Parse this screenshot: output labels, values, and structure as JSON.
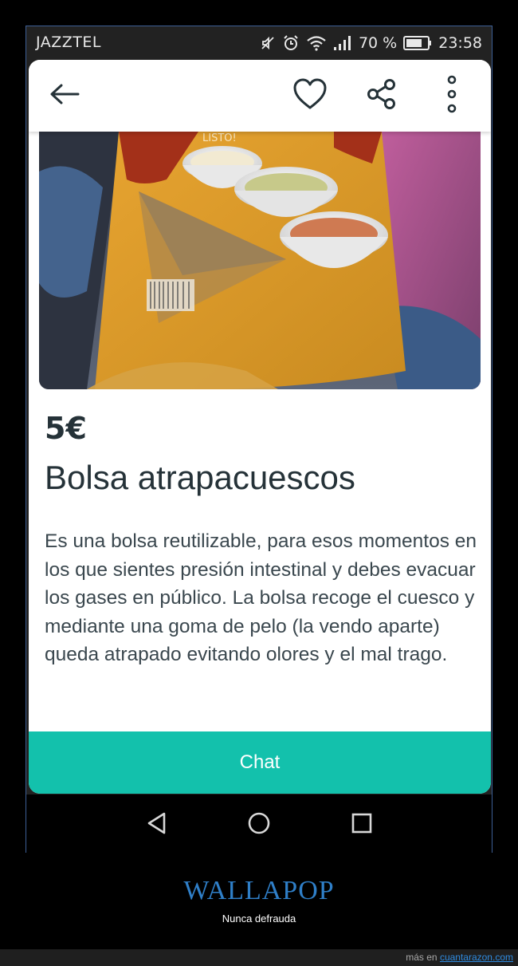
{
  "status_bar": {
    "carrier": "JAZZTEL",
    "battery_percent": "70 %",
    "time": "23:58",
    "icons": [
      "mute-icon",
      "alarm-icon",
      "wifi-icon",
      "signal-icon",
      "battery-icon"
    ]
  },
  "top_bar": {
    "icons": [
      "back-arrow-icon",
      "heart-icon",
      "share-icon",
      "more-vert-icon"
    ]
  },
  "product": {
    "price": "5€",
    "title": "Bolsa atrapacuescos",
    "description": "Es una bolsa reutilizable, para esos momentos en los que sientes presión intestinal y debes evacuar los gases en público. La bolsa recoge el cuesco y mediante una goma de pelo (la vendo aparte) queda atrapado evitando olores y el mal trago.",
    "photo_text": "LISTO!"
  },
  "chat_button": {
    "label": "Chat"
  },
  "nav_bar": {
    "icons": [
      "back-triangle-icon",
      "home-circle-icon",
      "recents-square-icon"
    ]
  },
  "caption": {
    "title": "WALLAPOP",
    "subtitle": "Nunca defrauda"
  },
  "footer": {
    "prefix": "más en",
    "link": "cuantarazon.com"
  },
  "colors": {
    "accent": "#13c1ac",
    "caption_title": "#2f7fc8",
    "text_dark": "#253238"
  }
}
